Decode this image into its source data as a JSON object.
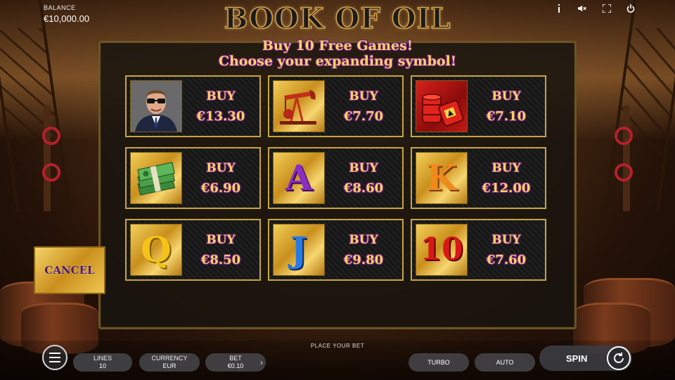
{
  "header": {
    "balance_label": "BALANCE",
    "balance_value": "€10,000.00",
    "logo_text": "BOOK OF OIL",
    "icons": [
      "info-icon",
      "sound-icon",
      "fullscreen-icon",
      "power-icon"
    ]
  },
  "dialog": {
    "line1": "Buy 10 Free Games!",
    "line2": "Choose your expanding symbol!",
    "buy_label": "BUY",
    "cancel_label": "CANCEL",
    "options": [
      {
        "symbol": "oil-tycoon",
        "price": "€13.30"
      },
      {
        "symbol": "oil-pump-jack",
        "price": "€7.70"
      },
      {
        "symbol": "oil-barrels",
        "price": "€7.10"
      },
      {
        "symbol": "cash-stack",
        "price": "€6.90"
      },
      {
        "symbol": "A",
        "price": "€8.60"
      },
      {
        "symbol": "K",
        "price": "€12.00"
      },
      {
        "symbol": "Q",
        "price": "€8.50"
      },
      {
        "symbol": "J",
        "price": "€9.80"
      },
      {
        "symbol": "10",
        "price": "€7.60"
      }
    ]
  },
  "footer": {
    "place_bet": "PLACE YOUR BET",
    "lines_label": "LINES",
    "lines_value": "10",
    "currency_label": "CURRENCY",
    "currency_value": "EUR",
    "bet_label": "BET",
    "bet_value": "€0.10",
    "turbo": "TURBO",
    "auto": "AUTO",
    "spin": "SPIN"
  },
  "colors": {
    "gold_text": "#ffd35a",
    "purple_outline": "#6a1d8a",
    "card_border": "#c9a441"
  }
}
